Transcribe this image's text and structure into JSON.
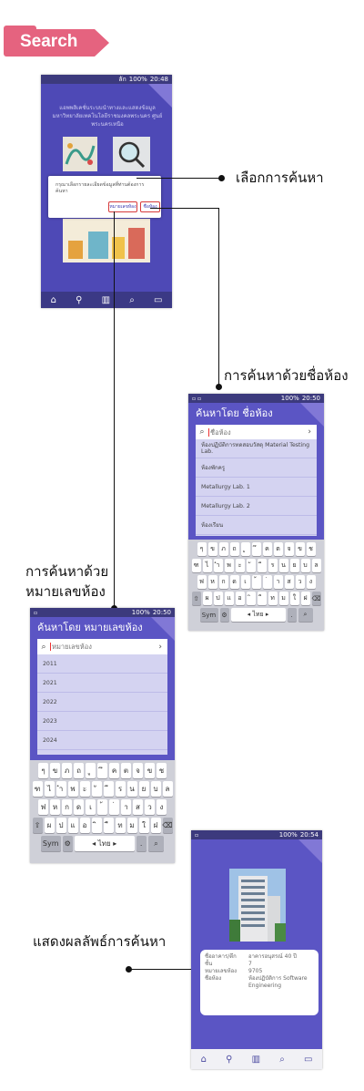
{
  "tag": {
    "label": "Search",
    "color": "#e5637f"
  },
  "colors": {
    "purple": "#5b55c4",
    "dark_nav": "#3b3985",
    "list_bg": "#d4d3f1",
    "highlight": "#d73a3a"
  },
  "phone1": {
    "status": {
      "signal": "ลัก",
      "battery": "100%",
      "time": "20:48"
    },
    "header_text": "แอพพลิเคชั่นระบบนำทางและแสดงข้อมูล มหาวิทยาลัยเทคโนโลยีราชมงคลพระนคร ศูนย์พระนครเหนือ",
    "dialog": {
      "message": "กรุณาเลือกรายละเอียดข้อมูลที่ท่านต้องการค้นหา",
      "button_room_number": "หมายเลขห้อง",
      "button_room_name": "ชื่อห้อง"
    },
    "nav_icons": [
      "home-icon",
      "location-icon",
      "map-icon",
      "search-icon",
      "book-icon"
    ]
  },
  "annotations": {
    "select_search": "เลือกการค้นหา",
    "search_by_name": "การค้นหาด้วยชื่อห้อง",
    "search_by_number_line1": "การค้นหาด้วย",
    "search_by_number_line2": "หมายเลขห้อง",
    "show_results": "แสดงผลลัพธ์การค้นหา"
  },
  "phone2": {
    "status": {
      "battery": "100%",
      "time": "20:50"
    },
    "title": "ค้นหาโดย ชื่อห้อง",
    "placeholder": "ชื่อห้อง",
    "items": [
      "ห้องปฏิบัติการทดสอบวัสดุ Material Testing Lab.",
      "ห้องพักครู",
      "Metallurgy Lab. 1",
      "Metallurgy Lab. 2",
      "ห้องเรียน"
    ],
    "keyboard": {
      "row1": [
        "ๆ",
        "ข",
        "ภ",
        "ถ",
        "ู",
        "ึ",
        "ค",
        "ต",
        "จ",
        "ข",
        "ช"
      ],
      "row2": [
        "ฑ",
        "ไ",
        "ำ",
        "พ",
        "ะ",
        "ั",
        "ี",
        "ร",
        "น",
        "ย",
        "บ",
        "ล"
      ],
      "row3": [
        "ฟ",
        "ห",
        "ก",
        "ด",
        "เ",
        "้",
        "่",
        "า",
        "ส",
        "ว",
        "ง"
      ],
      "row4": [
        "⇧",
        "ผ",
        "ป",
        "แ",
        "อ",
        "ิ",
        "ื",
        "ท",
        "ม",
        "ใ",
        "ฝ",
        "⌫"
      ],
      "sym": "Sym",
      "space": "◂ ไทย ▸",
      "dot": ".",
      "search_key": "⌕"
    }
  },
  "phone3": {
    "status": {
      "battery": "100%",
      "time": "20:50"
    },
    "title": "ค้นหาโดย หมายเลขห้อง",
    "placeholder": "หมายเลขห้อง",
    "items": [
      "2011",
      "2021",
      "2022",
      "2023",
      "2024"
    ]
  },
  "phone4": {
    "status": {
      "battery": "100%",
      "time": "20:54"
    },
    "info": [
      {
        "key": "ชื่ออาคาร/ตึก",
        "value": "อาคารอนุสรณ์ 40 ปี"
      },
      {
        "key": "ชั้น",
        "value": "7"
      },
      {
        "key": "หมายเลขห้อง",
        "value": "9705"
      },
      {
        "key": "ชื่อห้อง",
        "value": "ห้องปฏิบัติการ Software Engineering"
      }
    ]
  }
}
